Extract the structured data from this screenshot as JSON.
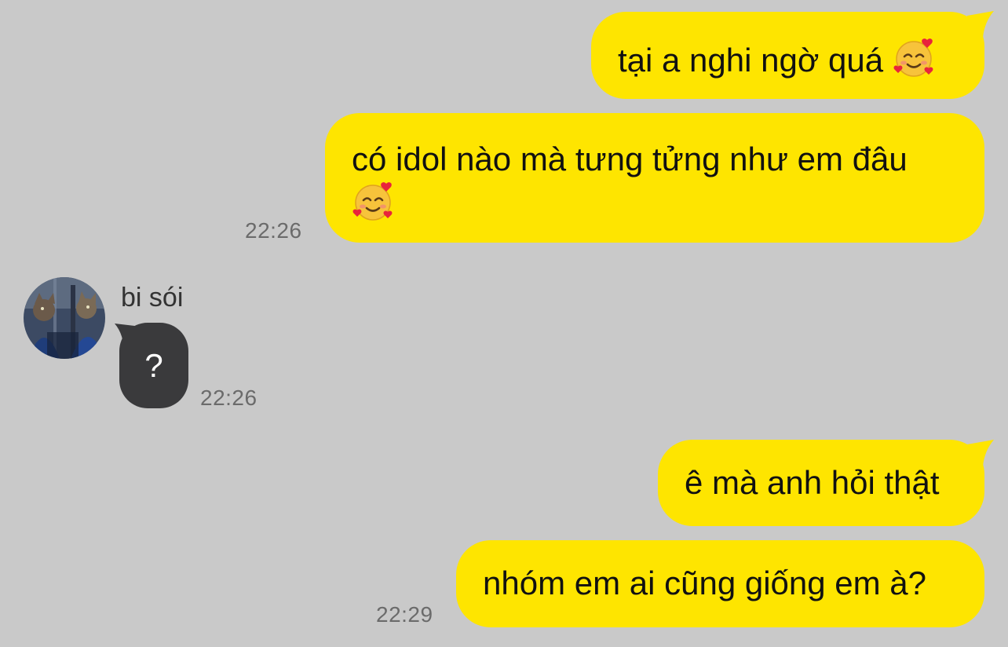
{
  "messages": [
    {
      "direction": "outgoing",
      "text": "tại a nghi ngờ quá",
      "emoji": "smiling-face-with-hearts-icon",
      "time": ""
    },
    {
      "direction": "outgoing",
      "text": "có idol nào mà tưng tửng như em đâu",
      "emoji": "smiling-face-with-hearts-icon",
      "time": "22:26"
    },
    {
      "direction": "incoming",
      "sender": "bi sói",
      "text": "?",
      "time": "22:26"
    },
    {
      "direction": "outgoing",
      "text": "ê mà anh hỏi thật",
      "time": ""
    },
    {
      "direction": "outgoing",
      "text": "nhóm em ai cũng giống em à?",
      "time": "22:29"
    }
  ],
  "colors": {
    "background": "#c9c9c9",
    "outgoing_bubble": "#fee500",
    "incoming_bubble": "#3a3a3c",
    "timestamp": "#6b6b6b"
  }
}
